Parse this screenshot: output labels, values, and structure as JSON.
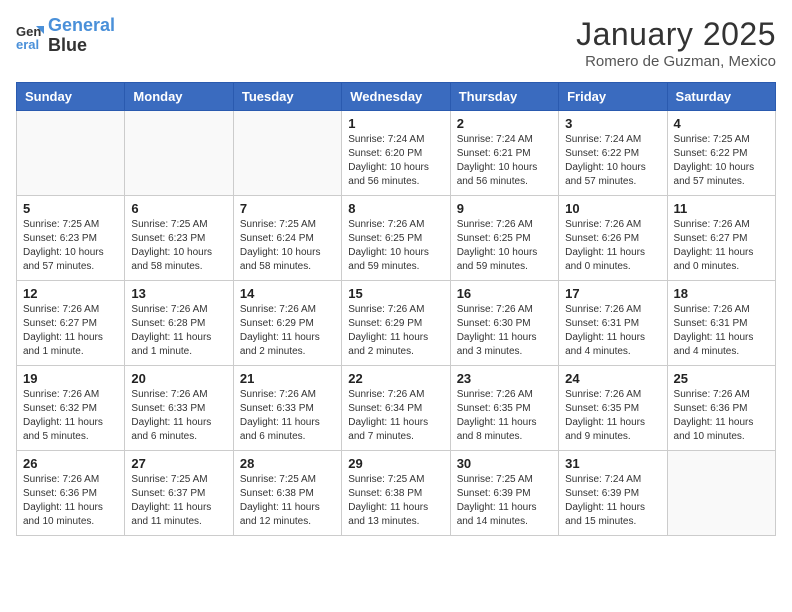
{
  "header": {
    "logo_line1": "General",
    "logo_line2": "Blue",
    "title": "January 2025",
    "subtitle": "Romero de Guzman, Mexico"
  },
  "days_of_week": [
    "Sunday",
    "Monday",
    "Tuesday",
    "Wednesday",
    "Thursday",
    "Friday",
    "Saturday"
  ],
  "weeks": [
    [
      {
        "day": "",
        "info": ""
      },
      {
        "day": "",
        "info": ""
      },
      {
        "day": "",
        "info": ""
      },
      {
        "day": "1",
        "info": "Sunrise: 7:24 AM\nSunset: 6:20 PM\nDaylight: 10 hours and 56 minutes."
      },
      {
        "day": "2",
        "info": "Sunrise: 7:24 AM\nSunset: 6:21 PM\nDaylight: 10 hours and 56 minutes."
      },
      {
        "day": "3",
        "info": "Sunrise: 7:24 AM\nSunset: 6:22 PM\nDaylight: 10 hours and 57 minutes."
      },
      {
        "day": "4",
        "info": "Sunrise: 7:25 AM\nSunset: 6:22 PM\nDaylight: 10 hours and 57 minutes."
      }
    ],
    [
      {
        "day": "5",
        "info": "Sunrise: 7:25 AM\nSunset: 6:23 PM\nDaylight: 10 hours and 57 minutes."
      },
      {
        "day": "6",
        "info": "Sunrise: 7:25 AM\nSunset: 6:23 PM\nDaylight: 10 hours and 58 minutes."
      },
      {
        "day": "7",
        "info": "Sunrise: 7:25 AM\nSunset: 6:24 PM\nDaylight: 10 hours and 58 minutes."
      },
      {
        "day": "8",
        "info": "Sunrise: 7:26 AM\nSunset: 6:25 PM\nDaylight: 10 hours and 59 minutes."
      },
      {
        "day": "9",
        "info": "Sunrise: 7:26 AM\nSunset: 6:25 PM\nDaylight: 10 hours and 59 minutes."
      },
      {
        "day": "10",
        "info": "Sunrise: 7:26 AM\nSunset: 6:26 PM\nDaylight: 11 hours and 0 minutes."
      },
      {
        "day": "11",
        "info": "Sunrise: 7:26 AM\nSunset: 6:27 PM\nDaylight: 11 hours and 0 minutes."
      }
    ],
    [
      {
        "day": "12",
        "info": "Sunrise: 7:26 AM\nSunset: 6:27 PM\nDaylight: 11 hours and 1 minute."
      },
      {
        "day": "13",
        "info": "Sunrise: 7:26 AM\nSunset: 6:28 PM\nDaylight: 11 hours and 1 minute."
      },
      {
        "day": "14",
        "info": "Sunrise: 7:26 AM\nSunset: 6:29 PM\nDaylight: 11 hours and 2 minutes."
      },
      {
        "day": "15",
        "info": "Sunrise: 7:26 AM\nSunset: 6:29 PM\nDaylight: 11 hours and 2 minutes."
      },
      {
        "day": "16",
        "info": "Sunrise: 7:26 AM\nSunset: 6:30 PM\nDaylight: 11 hours and 3 minutes."
      },
      {
        "day": "17",
        "info": "Sunrise: 7:26 AM\nSunset: 6:31 PM\nDaylight: 11 hours and 4 minutes."
      },
      {
        "day": "18",
        "info": "Sunrise: 7:26 AM\nSunset: 6:31 PM\nDaylight: 11 hours and 4 minutes."
      }
    ],
    [
      {
        "day": "19",
        "info": "Sunrise: 7:26 AM\nSunset: 6:32 PM\nDaylight: 11 hours and 5 minutes."
      },
      {
        "day": "20",
        "info": "Sunrise: 7:26 AM\nSunset: 6:33 PM\nDaylight: 11 hours and 6 minutes."
      },
      {
        "day": "21",
        "info": "Sunrise: 7:26 AM\nSunset: 6:33 PM\nDaylight: 11 hours and 6 minutes."
      },
      {
        "day": "22",
        "info": "Sunrise: 7:26 AM\nSunset: 6:34 PM\nDaylight: 11 hours and 7 minutes."
      },
      {
        "day": "23",
        "info": "Sunrise: 7:26 AM\nSunset: 6:35 PM\nDaylight: 11 hours and 8 minutes."
      },
      {
        "day": "24",
        "info": "Sunrise: 7:26 AM\nSunset: 6:35 PM\nDaylight: 11 hours and 9 minutes."
      },
      {
        "day": "25",
        "info": "Sunrise: 7:26 AM\nSunset: 6:36 PM\nDaylight: 11 hours and 10 minutes."
      }
    ],
    [
      {
        "day": "26",
        "info": "Sunrise: 7:26 AM\nSunset: 6:36 PM\nDaylight: 11 hours and 10 minutes."
      },
      {
        "day": "27",
        "info": "Sunrise: 7:25 AM\nSunset: 6:37 PM\nDaylight: 11 hours and 11 minutes."
      },
      {
        "day": "28",
        "info": "Sunrise: 7:25 AM\nSunset: 6:38 PM\nDaylight: 11 hours and 12 minutes."
      },
      {
        "day": "29",
        "info": "Sunrise: 7:25 AM\nSunset: 6:38 PM\nDaylight: 11 hours and 13 minutes."
      },
      {
        "day": "30",
        "info": "Sunrise: 7:25 AM\nSunset: 6:39 PM\nDaylight: 11 hours and 14 minutes."
      },
      {
        "day": "31",
        "info": "Sunrise: 7:24 AM\nSunset: 6:39 PM\nDaylight: 11 hours and 15 minutes."
      },
      {
        "day": "",
        "info": ""
      }
    ]
  ]
}
